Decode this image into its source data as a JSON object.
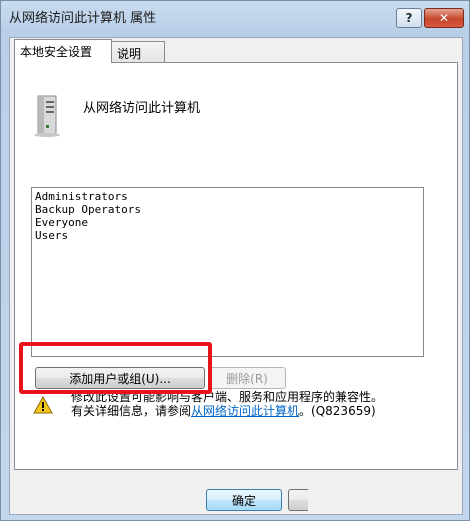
{
  "window": {
    "title": "从网络访问此计算机 属性",
    "help_label": "?",
    "close_label": "✕"
  },
  "tabs": [
    {
      "label": "本地安全设置"
    },
    {
      "label": "说明"
    }
  ],
  "policy": {
    "title": "从网络访问此计算机",
    "icon": "server-icon"
  },
  "members": [
    "Administrators",
    "Backup Operators",
    "Everyone",
    "Users"
  ],
  "buttons": {
    "add_label": "添加用户或组(U)...",
    "remove_label": "删除(R)",
    "ok_label": "确定"
  },
  "warning": {
    "line1": "修改此设置可能影响与客户端、服务和应用程序的兼容性。",
    "line2_prefix": "有关详细信息，请参阅",
    "link_text": "从网络访问此计算机",
    "kb": "。(Q823659)",
    "icon": "warning-icon"
  },
  "colors": {
    "highlight": "#e8131b",
    "link": "#0066cc"
  }
}
